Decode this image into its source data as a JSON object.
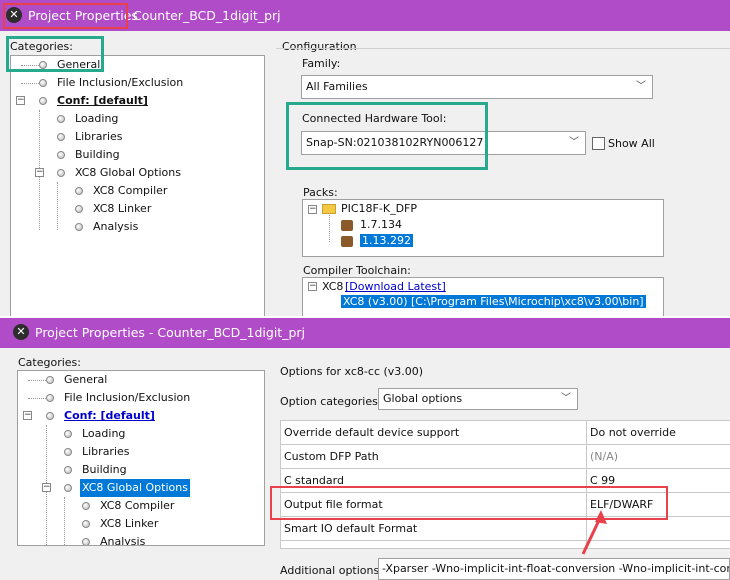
{
  "window1": {
    "title": "Project Properties",
    "project": "Counter_BCD_1digit_prj",
    "categories_label": "Categories:",
    "tree": [
      "General",
      "File Inclusion/Exclusion",
      "Conf: [default]",
      "Loading",
      "Libraries",
      "Building",
      "XC8 Global Options",
      "XC8 Compiler",
      "XC8 Linker",
      "Analysis"
    ],
    "configuration_label": "Configuration",
    "family_label": "Family:",
    "family_value": "All Families",
    "hardware_label": "Connected Hardware Tool:",
    "hardware_value": "Snap-SN:021038102RYN006127",
    "show_all_label": "Show All",
    "packs_label": "Packs:",
    "packs": {
      "root": "PIC18F-K_DFP",
      "versions": [
        "1.7.134",
        "1.13.292"
      ]
    },
    "toolchain_label": "Compiler Toolchain:",
    "toolchain": {
      "root": "XC8",
      "download_link": "[Download Latest]",
      "selected_item": "XC8 (v3.00) [C:\\Program Files\\Microchip\\xc8\\v3.00\\bin]"
    }
  },
  "window2": {
    "title": "Project Properties - Counter_BCD_1digit_prj",
    "categories_label": "Categories:",
    "tree": [
      "General",
      "File Inclusion/Exclusion",
      "Conf: [default]",
      "Loading",
      "Libraries",
      "Building",
      "XC8 Global Options",
      "XC8 Compiler",
      "XC8 Linker",
      "Analysis"
    ],
    "options_for": "Options for xc8-cc (v3.00)",
    "option_categories_label": "Option categories:",
    "option_categories_value": "Global options",
    "options": [
      {
        "name": "Override default device support",
        "value": "Do not override"
      },
      {
        "name": "Custom DFP Path",
        "value": "(N/A)"
      },
      {
        "name": "C standard",
        "value": "C 99"
      },
      {
        "name": "Output file format",
        "value": "ELF/DWARF"
      },
      {
        "name": "Smart IO default Format",
        "value": ""
      }
    ],
    "additional_options_label": "Additional options:",
    "additional_options_value": "-Xparser -Wno-implicit-int-float-conversion -Wno-implicit-int-conversion"
  },
  "colors": {
    "titlebar": "#b04cc8",
    "highlight_green": "#27a98e",
    "highlight_red": "#e8414b",
    "selection": "#0078d7"
  },
  "icons": [
    "app-logo-icon",
    "folder-icon",
    "package-icon",
    "chevron-down-icon",
    "red-arrow-icon"
  ]
}
